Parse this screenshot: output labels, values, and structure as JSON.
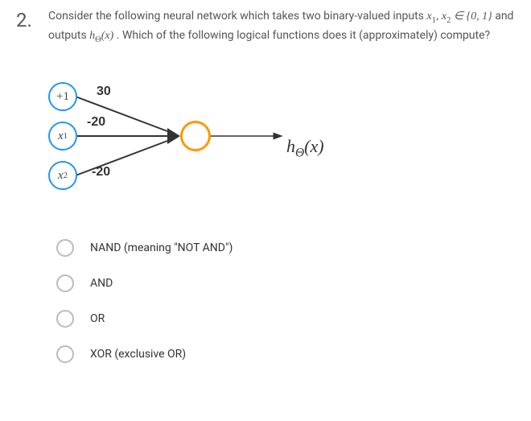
{
  "question": {
    "number": "2.",
    "prompt_pre": "Consider the following neural network which takes two binary-valued inputs ",
    "prompt_vars": "x₁, x₂ ∈ {0, 1}",
    "prompt_mid": " and outputs ",
    "prompt_fn": "hΘ(x)",
    "prompt_post": ". Which of the following logical functions does it (approximately) compute?"
  },
  "diagram": {
    "node_bias": "+1",
    "node_x1": "x₁",
    "node_x2": "x₂",
    "weight_bias": "30",
    "weight_x1": "-20",
    "weight_x2": "-20",
    "output_label": "hΘ(x)"
  },
  "options": [
    {
      "label": "NAND (meaning \"NOT AND\")"
    },
    {
      "label": "AND"
    },
    {
      "label": "OR"
    },
    {
      "label": "XOR (exclusive OR)"
    }
  ],
  "chart_data": {
    "type": "diagram",
    "description": "Single-layer neural network with bias node (+1), two inputs x1 and x2, weights 30, -20, -20 into one output unit hΘ(x).",
    "nodes": [
      {
        "id": "bias",
        "label": "+1"
      },
      {
        "id": "x1",
        "label": "x1"
      },
      {
        "id": "x2",
        "label": "x2"
      },
      {
        "id": "out",
        "label": "hΘ(x)"
      }
    ],
    "edges": [
      {
        "from": "bias",
        "to": "out",
        "weight": 30
      },
      {
        "from": "x1",
        "to": "out",
        "weight": -20
      },
      {
        "from": "x2",
        "to": "out",
        "weight": -20
      }
    ]
  }
}
